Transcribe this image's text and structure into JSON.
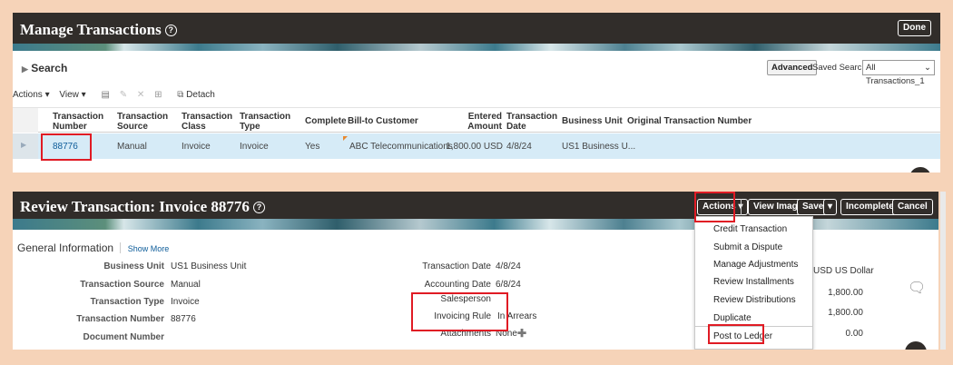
{
  "manage": {
    "title": "Manage Transactions",
    "help": "?",
    "done": "Done",
    "search_label": "Search",
    "advanced": "Advanced",
    "saved_search_label": "Saved Search",
    "saved_search_value": "All Transactions_1",
    "toolbar": {
      "actions": "Actions",
      "view": "View",
      "detach": "Detach"
    },
    "columns": [
      "Transaction Number",
      "Transaction Source",
      "Transaction Class",
      "Transaction Type",
      "Complete",
      "Bill-to Customer",
      "Entered Amount",
      "Transaction Date",
      "Business Unit",
      "Original Transaction Number"
    ],
    "row": {
      "number": "88776",
      "source": "Manual",
      "class": "Invoice",
      "type": "Invoice",
      "complete": "Yes",
      "customer": "ABC Telecommunications",
      "amount": "1,800.00 USD",
      "date": "4/8/24",
      "bu": "US1 Business U..."
    }
  },
  "review": {
    "title": "Review Transaction: Invoice 88776",
    "help": "?",
    "actions": "Actions",
    "view_image": "View Image",
    "save": "Save",
    "incomplete": "Incomplete",
    "cancel": "Cancel",
    "section": "General Information",
    "show_more": "Show More",
    "fields_left": [
      {
        "label": "Business Unit",
        "value": "US1 Business Unit"
      },
      {
        "label": "Transaction Source",
        "value": "Manual"
      },
      {
        "label": "Transaction Type",
        "value": "Invoice"
      },
      {
        "label": "Transaction Number",
        "value": "88776"
      },
      {
        "label": "Document Number",
        "value": ""
      }
    ],
    "fields_mid": [
      {
        "label": "Transaction Date",
        "value": "4/8/24"
      },
      {
        "label": "Accounting Date",
        "value": "6/8/24"
      },
      {
        "label": "Salesperson",
        "value": ""
      },
      {
        "label": "Invoicing Rule",
        "value": "In Arrears"
      },
      {
        "label": "Attachments",
        "value": "None"
      }
    ],
    "menu": [
      "Credit Transaction",
      "Submit a Dispute",
      "Manage Adjustments",
      "Review Installments",
      "Review Distributions",
      "Duplicate",
      "Post to Ledger"
    ],
    "right": {
      "currency": "USD US Dollar",
      "v1": "1,800.00",
      "v2": "1,800.00",
      "v3": "0.00"
    }
  },
  "colors": {
    "header": "#312d2a",
    "highlight": "#e01b24",
    "link": "#0d5c99",
    "selected_row": "#d6ebf7"
  }
}
